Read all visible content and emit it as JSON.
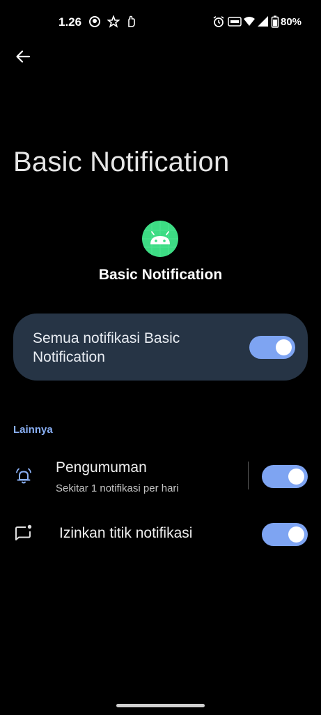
{
  "status_bar": {
    "time": "1.26",
    "battery": "80%",
    "icons": [
      "face-icon",
      "star-icon",
      "hand-icon",
      "alarm-icon",
      "volte-icon",
      "wifi-icon",
      "signal-icon",
      "battery-icon"
    ]
  },
  "toolbar": {
    "back_icon": "arrow-back-icon"
  },
  "page": {
    "title": "Basic Notification"
  },
  "app": {
    "name": "Basic Notification",
    "icon": "android-icon",
    "icon_color": "#3ddc84"
  },
  "master_switch": {
    "label": "Semua notifikasi Basic Notification",
    "checked": true
  },
  "section": {
    "header": "Lainnya",
    "rows": [
      {
        "icon": "bell-ring-icon",
        "title": "Pengumuman",
        "subtitle": "Sekitar 1 notifikasi per hari",
        "checked": true
      },
      {
        "icon": "notification-dot-icon",
        "title": "Izinkan titik notifikasi",
        "checked": true
      }
    ]
  },
  "colors": {
    "background": "#000000",
    "card": "#263445",
    "accent": "#7ea4f2",
    "section_header": "#8ab0f5"
  }
}
